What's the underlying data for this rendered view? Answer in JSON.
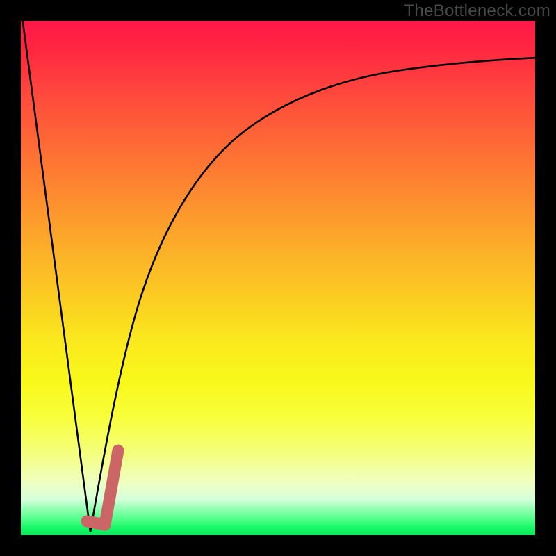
{
  "watermark": "TheBottleneck.com",
  "chart_data": {
    "type": "line",
    "title": "",
    "xlabel": "",
    "ylabel": "",
    "xlim": [
      0,
      100
    ],
    "ylim": [
      0,
      100
    ],
    "grid": false,
    "legend": false,
    "series": [
      {
        "name": "left-descent",
        "color": "#000000",
        "x": [
          0,
          13
        ],
        "values": [
          100,
          0
        ]
      },
      {
        "name": "saturating-curve",
        "color": "#000000",
        "x": [
          13,
          18,
          23,
          28,
          33,
          40,
          48,
          56,
          65,
          75,
          85,
          95,
          100
        ],
        "values": [
          0,
          25,
          42,
          54,
          62,
          70,
          77,
          82,
          85.5,
          88,
          89.7,
          90.8,
          91.2
        ]
      },
      {
        "name": "highlight-tick",
        "color": "#cc6666",
        "thick": true,
        "x": [
          12,
          16,
          18
        ],
        "values": [
          1.5,
          1.5,
          16
        ]
      }
    ],
    "gradient_stops": [
      {
        "pos": 0,
        "color": "#ff1848"
      },
      {
        "pos": 50,
        "color": "#fbd021"
      },
      {
        "pos": 75,
        "color": "#f9f81a"
      },
      {
        "pos": 100,
        "color": "#08e858"
      }
    ]
  }
}
